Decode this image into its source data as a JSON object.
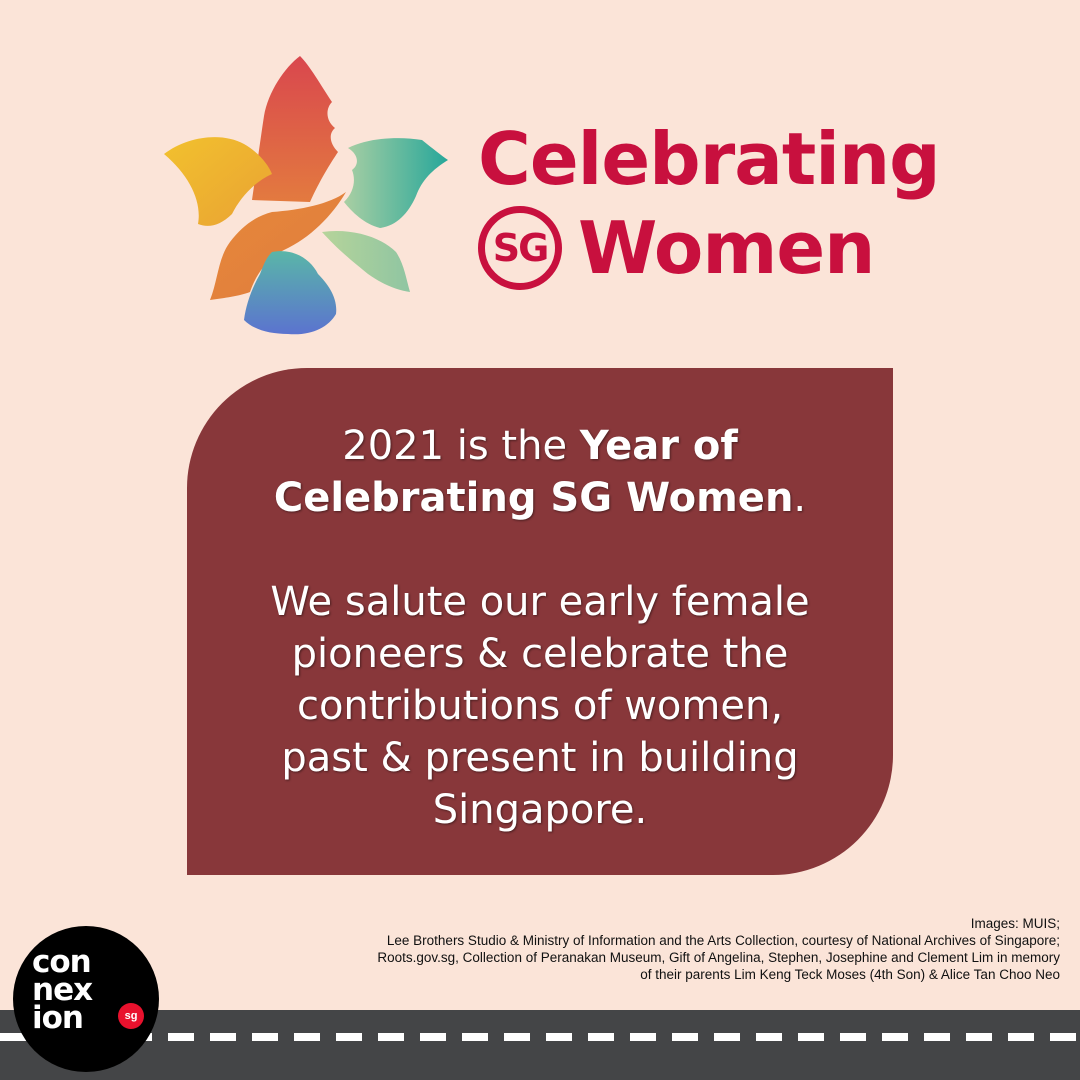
{
  "logo": {
    "line1": "Celebrating",
    "badge": "SG",
    "line2": "Women",
    "colors": {
      "brand_red": "#c8103e"
    }
  },
  "panel": {
    "p1_pre": "2021 is the ",
    "p1_bold_a": "Year of",
    "p1_bold_b": "Celebrating SG Women",
    "p1_post": ".",
    "p2_lines": [
      "We salute our early female",
      "pioneers & celebrate the",
      "contributions of women,",
      "past & present in building",
      "Singapore."
    ],
    "colors": {
      "background": "#88373a",
      "text": "#ffffff"
    }
  },
  "credits": {
    "lines": [
      "Images: MUIS;",
      "Lee Brothers Studio & Ministry of Information and the Arts Collection, courtesy of National Archives of Singapore;",
      "Roots.gov.sg, Collection of Peranakan Museum, Gift of Angelina, Stephen, Josephine and Clement Lim in memory",
      "of their parents Lim Keng Teck Moses (4th Son) & Alice Tan Choo Neo"
    ]
  },
  "brand_badge": {
    "rows": [
      "con",
      "nex",
      "ion"
    ],
    "suffix": "sg",
    "colors": {
      "background": "#000000",
      "accent": "#e8112d"
    }
  },
  "colors": {
    "page_background": "#fbe4d8",
    "road": "#444547"
  }
}
